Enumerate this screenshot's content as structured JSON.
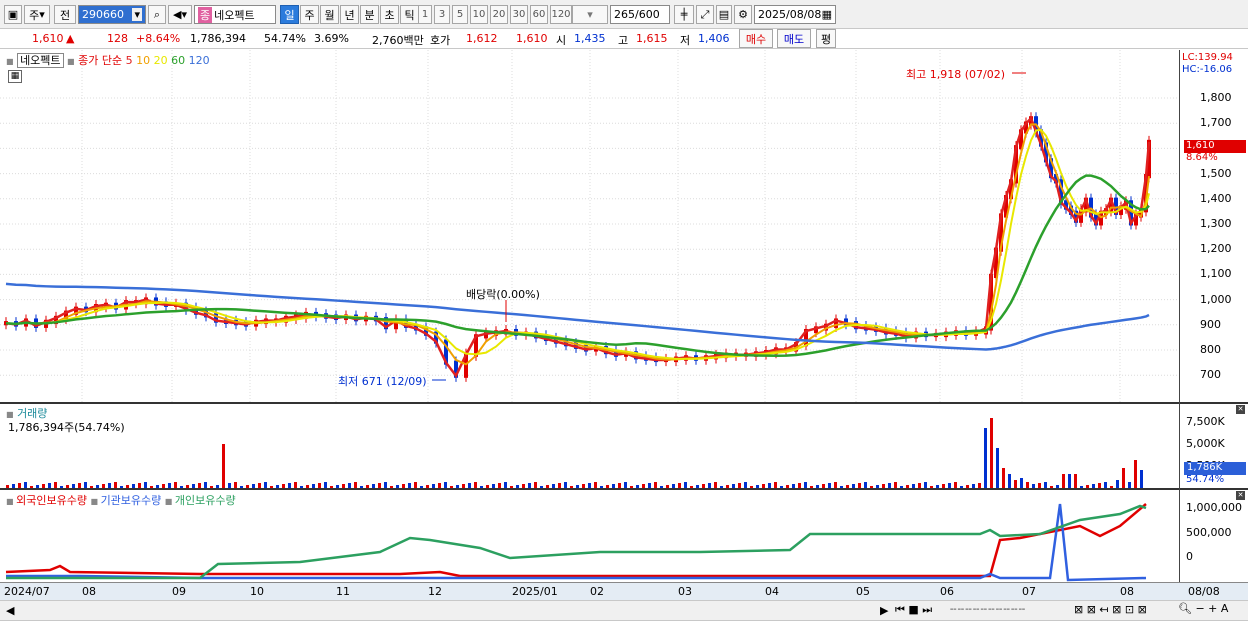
{
  "toolbar": {
    "type_label": "주",
    "prev_label": "전",
    "code": "290660",
    "stock_name": "네오펙트",
    "periods": [
      "일",
      "주",
      "월",
      "년",
      "분",
      "초",
      "틱"
    ],
    "intervals": [
      "1",
      "3",
      "5",
      "10",
      "20",
      "30",
      "60",
      "120"
    ],
    "count": "265",
    "count_max": "/600",
    "date": "2025/08/08",
    "colors": {
      "accent": "#2b7bdc",
      "up": "#e00000",
      "down": "#0030d0"
    }
  },
  "quote": {
    "price": "1,610",
    "arrow": "▲",
    "change": "128",
    "change_pct": "+8.64%",
    "volume": "1,786,394",
    "volume_ratio": "54.74%",
    "turnover": "3.69%",
    "amount": "2,760백만",
    "ask_label": "호가",
    "ask1": "1,612",
    "ask2": "1,610",
    "open_label": "시",
    "open": "1,435",
    "high_label": "고",
    "high": "1,615",
    "low_label": "저",
    "low": "1,406",
    "buy_label": "매수",
    "sell_label": "매도",
    "avg_label": "평"
  },
  "price_panel": {
    "name_tag": "네오펙트",
    "ma_label": "종가 단순",
    "ma_periods": [
      {
        "label": "5",
        "color": "#e02020"
      },
      {
        "label": "10",
        "color": "#f0a000"
      },
      {
        "label": "20",
        "color": "#e8e800"
      },
      {
        "label": "60",
        "color": "#2ca02c"
      },
      {
        "label": "120",
        "color": "#3a6fd8"
      }
    ],
    "lc": "LC:139.94",
    "hc": "HC:-16.06",
    "y_ticks": [
      "1,800",
      "1,700",
      "1,600",
      "1,500",
      "1,400",
      "1,300",
      "1,200",
      "1,100",
      "1,000",
      "900",
      "800",
      "700"
    ],
    "last_price": "1,610",
    "last_pct": "8.64%",
    "high_note": "최고 1,918 (07/02)",
    "low_note": "최저 671 (12/09)",
    "div_note": "배당락(0.00%)"
  },
  "volume_panel": {
    "title": "거래량",
    "value": "1,786,394주(54.74%)",
    "y_ticks": [
      "7,500K",
      "5,000K",
      "2,500K"
    ],
    "last": "1,786K",
    "last_pct": "54.74%"
  },
  "holders_panel": {
    "series": [
      {
        "label": "외국인보유수량",
        "color": "#e00000"
      },
      {
        "label": "기관보유수량",
        "color": "#3060e0"
      },
      {
        "label": "개인보유수량",
        "color": "#2ca060"
      }
    ],
    "y_ticks": [
      "1,000,000",
      "500,000",
      "0"
    ]
  },
  "x_axis": {
    "labels": [
      "2024/07",
      "08",
      "09",
      "10",
      "11",
      "12",
      "2025/01",
      "02",
      "03",
      "04",
      "05",
      "06",
      "07",
      "08"
    ],
    "right_label": "08/08"
  },
  "chart_data": {
    "type": "line",
    "title": "네오펙트",
    "ylim": [
      620,
      1960
    ],
    "price_series": [
      [
        0,
        920
      ],
      [
        10,
        915
      ],
      [
        20,
        930
      ],
      [
        30,
        910
      ],
      [
        40,
        925
      ],
      [
        50,
        940
      ],
      [
        60,
        960
      ],
      [
        70,
        975
      ],
      [
        80,
        970
      ],
      [
        90,
        985
      ],
      [
        100,
        990
      ],
      [
        110,
        980
      ],
      [
        120,
        1000
      ],
      [
        130,
        1000
      ],
      [
        140,
        1010
      ],
      [
        150,
        995
      ],
      [
        160,
        990
      ],
      [
        170,
        990
      ],
      [
        180,
        975
      ],
      [
        190,
        960
      ],
      [
        200,
        950
      ],
      [
        210,
        930
      ],
      [
        220,
        925
      ],
      [
        230,
        920
      ],
      [
        240,
        915
      ],
      [
        250,
        925
      ],
      [
        260,
        930
      ],
      [
        270,
        930
      ],
      [
        280,
        940
      ],
      [
        290,
        945
      ],
      [
        300,
        955
      ],
      [
        310,
        950
      ],
      [
        320,
        945
      ],
      [
        330,
        940
      ],
      [
        340,
        945
      ],
      [
        350,
        935
      ],
      [
        360,
        940
      ],
      [
        370,
        935
      ],
      [
        380,
        905
      ],
      [
        390,
        930
      ],
      [
        400,
        910
      ],
      [
        410,
        900
      ],
      [
        420,
        880
      ],
      [
        430,
        850
      ],
      [
        440,
        770
      ],
      [
        450,
        720
      ],
      [
        460,
        800
      ],
      [
        470,
        870
      ],
      [
        480,
        880
      ],
      [
        490,
        885
      ],
      [
        500,
        890
      ],
      [
        510,
        880
      ],
      [
        520,
        880
      ],
      [
        530,
        870
      ],
      [
        540,
        860
      ],
      [
        550,
        850
      ],
      [
        560,
        840
      ],
      [
        570,
        830
      ],
      [
        580,
        820
      ],
      [
        590,
        825
      ],
      [
        600,
        810
      ],
      [
        610,
        800
      ],
      [
        620,
        805
      ],
      [
        630,
        790
      ],
      [
        640,
        785
      ],
      [
        650,
        780
      ],
      [
        660,
        780
      ],
      [
        670,
        785
      ],
      [
        680,
        790
      ],
      [
        690,
        785
      ],
      [
        700,
        790
      ],
      [
        710,
        795
      ],
      [
        720,
        800
      ],
      [
        730,
        800
      ],
      [
        740,
        800
      ],
      [
        750,
        805
      ],
      [
        760,
        810
      ],
      [
        770,
        820
      ],
      [
        780,
        820
      ],
      [
        790,
        840
      ],
      [
        800,
        890
      ],
      [
        810,
        900
      ],
      [
        820,
        910
      ],
      [
        830,
        930
      ],
      [
        840,
        920
      ],
      [
        850,
        905
      ],
      [
        860,
        900
      ],
      [
        870,
        895
      ],
      [
        880,
        885
      ],
      [
        890,
        880
      ],
      [
        900,
        870
      ],
      [
        910,
        880
      ],
      [
        920,
        875
      ],
      [
        930,
        875
      ],
      [
        940,
        880
      ],
      [
        950,
        885
      ],
      [
        960,
        880
      ],
      [
        970,
        885
      ],
      [
        980,
        900
      ],
      [
        985,
        1100
      ],
      [
        990,
        1200
      ],
      [
        995,
        1330
      ],
      [
        1000,
        1400
      ],
      [
        1005,
        1460
      ],
      [
        1010,
        1590
      ],
      [
        1015,
        1650
      ],
      [
        1020,
        1680
      ],
      [
        1025,
        1700
      ],
      [
        1030,
        1650
      ],
      [
        1035,
        1600
      ],
      [
        1040,
        1540
      ],
      [
        1045,
        1480
      ],
      [
        1050,
        1460
      ],
      [
        1055,
        1380
      ],
      [
        1060,
        1360
      ],
      [
        1065,
        1340
      ],
      [
        1070,
        1310
      ],
      [
        1075,
        1350
      ],
      [
        1080,
        1390
      ],
      [
        1085,
        1330
      ],
      [
        1090,
        1300
      ],
      [
        1095,
        1340
      ],
      [
        1100,
        1350
      ],
      [
        1105,
        1390
      ],
      [
        1110,
        1340
      ],
      [
        1115,
        1360
      ],
      [
        1120,
        1380
      ],
      [
        1125,
        1300
      ],
      [
        1130,
        1330
      ],
      [
        1135,
        1350
      ],
      [
        1140,
        1480
      ],
      [
        1143,
        1610
      ]
    ]
  }
}
